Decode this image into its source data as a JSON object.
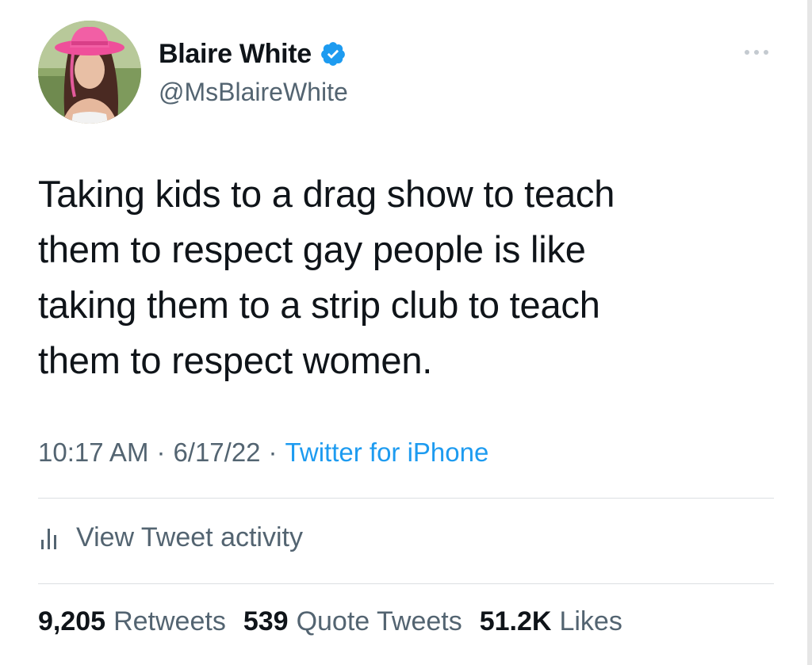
{
  "author": {
    "display_name": "Blaire White",
    "handle": "@MsBlaireWhite",
    "avatar_icon": "profile-photo-avatar",
    "verified_icon": "verified-badge-icon"
  },
  "tweet": {
    "text": "Taking kids to a drag show to teach\nthem to respect gay people is like\ntaking them to a strip club to teach\nthem to respect women."
  },
  "meta": {
    "time": "10:17 AM",
    "separator": "·",
    "date": "6/17/22",
    "source": "Twitter for iPhone"
  },
  "activity": {
    "label": "View Tweet activity",
    "icon": "bar-chart-icon"
  },
  "stats": {
    "retweets_count": "9,205",
    "retweets_label": "Retweets",
    "quotes_count": "539",
    "quotes_label": "Quote Tweets",
    "likes_count": "51.2K",
    "likes_label": "Likes"
  },
  "colors": {
    "text_primary": "#0f1419",
    "text_secondary": "#536471",
    "accent_link": "#1d9bf0",
    "divider": "#dcdfe2",
    "verified_badge": "#1d9bf0"
  }
}
